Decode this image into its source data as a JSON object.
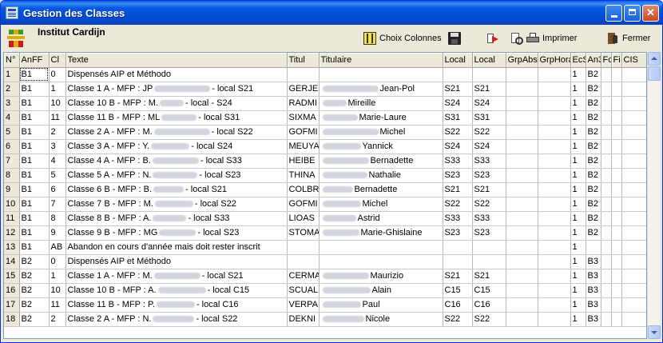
{
  "window": {
    "title": "Gestion des Classes"
  },
  "header": {
    "org_name": "Institut Cardijn"
  },
  "toolbar": {
    "choose_columns_label": "Choix Colonnes",
    "print_label": "Imprimer",
    "close_label": "Fermer"
  },
  "icons": [
    "app-icon",
    "logo",
    "columns-icon",
    "save-icon",
    "export-icon",
    "print-preview-icon",
    "printer-icon",
    "exit-icon"
  ],
  "grid": {
    "columns": [
      "N°",
      "AnFF",
      "Cl",
      "Texte",
      "Titul",
      "Titulaire",
      "Local",
      "Local",
      "GrpAbs",
      "GrpHora",
      "EcS",
      "An3",
      "Fo",
      "Fi",
      "CIS"
    ],
    "rows": [
      {
        "n": "1",
        "anff": "B1",
        "cl": "0",
        "texte_pre": "Dispensés AIP et Méthodo",
        "texte_post": "",
        "titul": "",
        "titulaire": "",
        "local1": "",
        "local2": "",
        "grpabs": "",
        "grphora": "",
        "ecs": "1",
        "an3": "B2"
      },
      {
        "n": "2",
        "anff": "B1",
        "cl": "1",
        "texte_pre": "Classe 1 A - MFP : JP",
        "texte_post": "- local S21",
        "titul": "GERJE",
        "titulaire": "Jean-Pol",
        "local1": "S21",
        "local2": "S21",
        "grpabs": "",
        "grphora": "",
        "ecs": "1",
        "an3": "B2"
      },
      {
        "n": "3",
        "anff": "B1",
        "cl": "10",
        "texte_pre": "Classe 10 B - MFP : M.",
        "texte_post": "- local - S24",
        "titul": "RADMI",
        "titulaire": "Mireille",
        "local1": "S24",
        "local2": "S24",
        "grpabs": "",
        "grphora": "",
        "ecs": "1",
        "an3": "B2"
      },
      {
        "n": "4",
        "anff": "B1",
        "cl": "11",
        "texte_pre": "Classe 11 B - MFP : ML",
        "texte_post": "- local S31",
        "titul": "SIXMA",
        "titulaire": "Marie-Laure",
        "local1": "S31",
        "local2": "S31",
        "grpabs": "",
        "grphora": "",
        "ecs": "1",
        "an3": "B2"
      },
      {
        "n": "5",
        "anff": "B1",
        "cl": "2",
        "texte_pre": "Classe 2 A - MFP : M.",
        "texte_post": "- local S22",
        "titul": "GOFMI",
        "titulaire": "Michel",
        "local1": "S22",
        "local2": "S22",
        "grpabs": "",
        "grphora": "",
        "ecs": "1",
        "an3": "B2"
      },
      {
        "n": "6",
        "anff": "B1",
        "cl": "3",
        "texte_pre": "Classe 3 A - MFP : Y.",
        "texte_post": "- local S24",
        "titul": "MEUYA",
        "titulaire": "Yannick",
        "local1": "S24",
        "local2": "S24",
        "grpabs": "",
        "grphora": "",
        "ecs": "1",
        "an3": "B2"
      },
      {
        "n": "7",
        "anff": "B1",
        "cl": "4",
        "texte_pre": "Classe 4 A - MFP : B.",
        "texte_post": "- local S33",
        "titul": "HEIBE",
        "titulaire": "Bernadette",
        "local1": "S33",
        "local2": "S33",
        "grpabs": "",
        "grphora": "",
        "ecs": "1",
        "an3": "B2"
      },
      {
        "n": "8",
        "anff": "B1",
        "cl": "5",
        "texte_pre": "Classe 5 A - MFP : N.",
        "texte_post": "- local S23",
        "titul": "THINA",
        "titulaire": "Nathalie",
        "local1": "S23",
        "local2": "S23",
        "grpabs": "",
        "grphora": "",
        "ecs": "1",
        "an3": "B2"
      },
      {
        "n": "9",
        "anff": "B1",
        "cl": "6",
        "texte_pre": "Classe 6 B - MFP : B.",
        "texte_post": "- local S21",
        "titul": "COLBR",
        "titulaire": "Bernadette",
        "local1": "S21",
        "local2": "S21",
        "grpabs": "",
        "grphora": "",
        "ecs": "1",
        "an3": "B2"
      },
      {
        "n": "10",
        "anff": "B1",
        "cl": "7",
        "texte_pre": "Classe 7 B - MFP : M.",
        "texte_post": "- local S22",
        "titul": "GOFMI",
        "titulaire": "Michel",
        "local1": "S22",
        "local2": "S22",
        "grpabs": "",
        "grphora": "",
        "ecs": "1",
        "an3": "B2"
      },
      {
        "n": "11",
        "anff": "B1",
        "cl": "8",
        "texte_pre": "Classe 8 B - MFP : A.",
        "texte_post": "- local S33",
        "titul": "LIOAS",
        "titulaire": "Astrid",
        "local1": "S33",
        "local2": "S33",
        "grpabs": "",
        "grphora": "",
        "ecs": "1",
        "an3": "B2"
      },
      {
        "n": "12",
        "anff": "B1",
        "cl": "9",
        "texte_pre": "Classe 9 B - MFP : MG",
        "texte_post": "- local S23",
        "titul": "STOMA",
        "titulaire": "Marie-Ghislaine",
        "local1": "S23",
        "local2": "S23",
        "grpabs": "",
        "grphora": "",
        "ecs": "1",
        "an3": "B2"
      },
      {
        "n": "13",
        "anff": "B1",
        "cl": "AB",
        "texte_pre": "Abandon en cours d'année mais doit rester inscrit",
        "texte_post": "",
        "titul": "",
        "titulaire": "",
        "local1": "",
        "local2": "",
        "grpabs": "",
        "grphora": "",
        "ecs": "1",
        "an3": ""
      },
      {
        "n": "14",
        "anff": "B2",
        "cl": "0",
        "texte_pre": "Dispensés AIP et Méthodo",
        "texte_post": "",
        "titul": "",
        "titulaire": "",
        "local1": "",
        "local2": "",
        "grpabs": "",
        "grphora": "",
        "ecs": "1",
        "an3": "B3"
      },
      {
        "n": "15",
        "anff": "B2",
        "cl": "1",
        "texte_pre": "Classe 1 A - MFP : M.",
        "texte_post": "- local S21",
        "titul": "CERMA",
        "titulaire": "Maurizio",
        "local1": "S21",
        "local2": "S21",
        "grpabs": "",
        "grphora": "",
        "ecs": "1",
        "an3": "B3"
      },
      {
        "n": "16",
        "anff": "B2",
        "cl": "10",
        "texte_pre": "Classe 10 B -  MFP : A.",
        "texte_post": "- local C15",
        "titul": "SCUAL",
        "titulaire": "Alain",
        "local1": "C15",
        "local2": "C15",
        "grpabs": "",
        "grphora": "",
        "ecs": "1",
        "an3": "B3"
      },
      {
        "n": "17",
        "anff": "B2",
        "cl": "11",
        "texte_pre": "Classe 11 B - MFP : P.",
        "texte_post": "- local C16",
        "titul": "VERPA",
        "titulaire": "Paul",
        "local1": "C16",
        "local2": "C16",
        "grpabs": "",
        "grphora": "",
        "ecs": "1",
        "an3": "B3"
      },
      {
        "n": "18",
        "anff": "B2",
        "cl": "2",
        "texte_pre": "Classe 2 A - MFP : N.",
        "texte_post": "- local S22",
        "titul": "DEKNI",
        "titulaire": "Nicole",
        "local1": "S22",
        "local2": "S22",
        "grpabs": "",
        "grphora": "",
        "ecs": "1",
        "an3": "B3"
      }
    ]
  }
}
